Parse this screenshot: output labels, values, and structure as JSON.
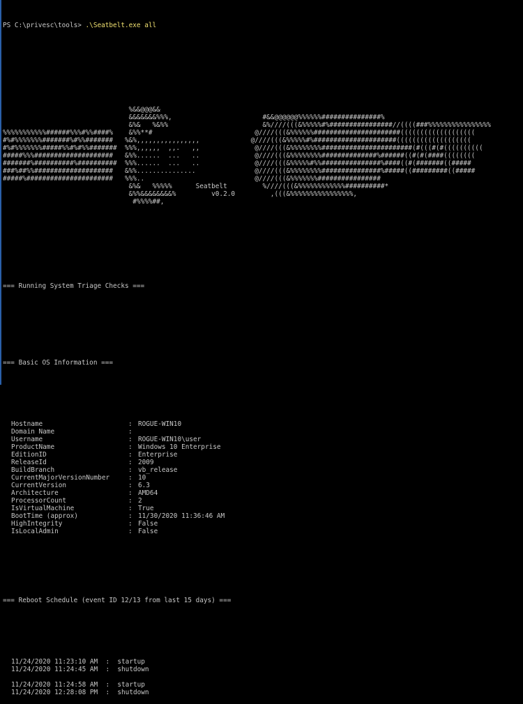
{
  "prompt": {
    "text": "PS C:\\privesc\\tools> ",
    "command": ".\\Seatbelt.exe all"
  },
  "banner": [
    "                                %&&@@@&&                                                                                  ",
    "                                &&&&&&&%%%,                       #&&@@@@@@%%%%%%###############%                       ",
    "                                &%&   %&%%                        &%////(((&%%%%%#%################//((((###%%%%%%%%%%%%%%%%",
    "%%%%%%%%%%%######%%%#%%####%    &%%**#                          @////(((&%%%%%%######################(((((((((((((((((((",
    "#%#%%%%%%%#######%#%%#######   %&%,,,,,,,,,,,,,,,,             @////(((&%%%%%#%#####################(((((((((((((((((((",
    "#%#%%%%%%%#####%%#%#%%#######  %%%,,,,,,  ,,.   ,,              @////(((&%%%%%%%%#######################(#(((#(#((((((((((",
    "#####%%%####################   &%%......  ...   ..              @////(((&%%%%%%%%##############%######((#(#(####((((((((",
    "#######%##########%##########  %%%......  ...   ..              @////(((&%%%%%#%%###############%####((#(#######((#####",
    "###%##%%####################   &%%...............               @////(((&%%%%%%%%###############%#####((#########((#####",
    "#####%######################   %%%..                            @////(((&%%%%%%%################",
    "                                &%&   %%%%%      Seatbelt         %////(((&%%%%%%%%%%%%##########*",
    "                                &%%&&&&&&&&%         v0.2.0         ,(((&%%%%%%%%%%%%%%%%,",
    "                                 #%%%%##,"
  ],
  "sections": {
    "triage_header": "=== Running System Triage Checks ===",
    "os_header": "=== Basic OS Information ===",
    "reboot_header": "=== Reboot Schedule (event ID 12/13 from last 15 days) ==="
  },
  "os_info": [
    {
      "key": "Hostname",
      "value": "ROGUE-WIN10"
    },
    {
      "key": "Domain Name",
      "value": ""
    },
    {
      "key": "Username",
      "value": "ROGUE-WIN10\\user"
    },
    {
      "key": "ProductName",
      "value": "Windows 10 Enterprise"
    },
    {
      "key": "EditionID",
      "value": "Enterprise"
    },
    {
      "key": "ReleaseId",
      "value": "2009"
    },
    {
      "key": "BuildBranch",
      "value": "vb_release"
    },
    {
      "key": "CurrentMajorVersionNumber",
      "value": "10"
    },
    {
      "key": "CurrentVersion",
      "value": "6.3"
    },
    {
      "key": "Architecture",
      "value": "AMD64"
    },
    {
      "key": "ProcessorCount",
      "value": "2"
    },
    {
      "key": "IsVirtualMachine",
      "value": "True"
    },
    {
      "key": "BootTime (approx)",
      "value": "11/30/2020 11:36:46 AM"
    },
    {
      "key": "HighIntegrity",
      "value": "False"
    },
    {
      "key": "IsLocalAdmin",
      "value": "False"
    }
  ],
  "kv_separator": ":",
  "reboot_events": [
    {
      "text": "11/24/2020 11:23:10 AM  :  startup"
    },
    {
      "text": "11/24/2020 11:24:45 AM  :  shutdown"
    },
    {
      "text": ""
    },
    {
      "text": "11/24/2020 11:24:58 AM  :  startup"
    },
    {
      "text": "11/24/2020 12:28:08 PM  :  shutdown"
    }
  ],
  "colors": {
    "background": "#000000",
    "text": "#c8c8c8",
    "command": "#f0e070",
    "window_edge": "#2a5fa8"
  }
}
